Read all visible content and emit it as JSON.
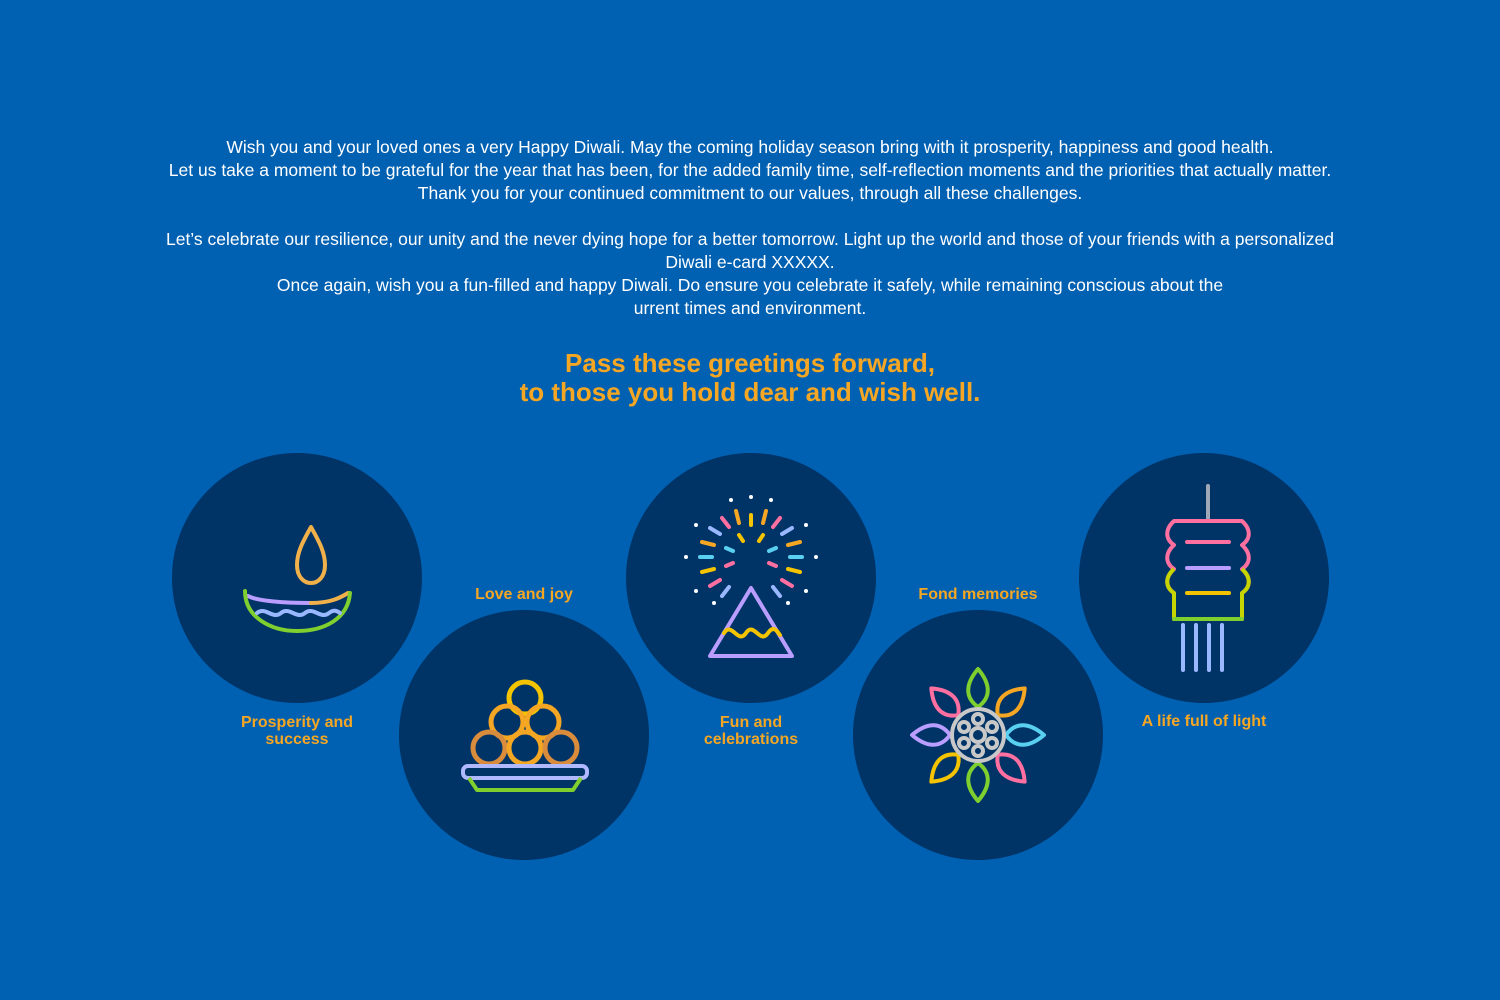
{
  "message": {
    "lines": [
      "Wish you and your loved ones a very Happy Diwali. May the coming holiday season bring with it prosperity, happiness and good health.",
      "Let us take a moment to be grateful for the year that has been, for the added family time, self-reflection moments and the priorities that actually matter.",
      "Thank you for your continued commitment to our values, through all these challenges.",
      "Let’s celebrate our resilience, our unity and the never dying hope for a better tomorrow. Light up the world and those of your friends with a personalized",
      "Diwali e-card XXXXX.",
      "Once again, wish you a fun-filled and happy Diwali. Do ensure you celebrate it safely, while remaining conscious about the",
      "urrent times and environment."
    ]
  },
  "cta": {
    "line1": "Pass these greetings forward,",
    "line2": "to those you hold dear and wish well."
  },
  "cards": [
    {
      "icon": "diya-lamp-icon",
      "label_line1": "Prosperity and",
      "label_line2": "success"
    },
    {
      "icon": "sweets-plate-icon",
      "label_line1": "Love and joy",
      "label_line2": ""
    },
    {
      "icon": "fireworks-icon",
      "label_line1": "Fun and",
      "label_line2": "celebrations"
    },
    {
      "icon": "rangoli-flower-icon",
      "label_line1": "Fond memories",
      "label_line2": ""
    },
    {
      "icon": "hanging-lantern-icon",
      "label_line1": "A life full of light",
      "label_line2": ""
    }
  ],
  "colors": {
    "background": "#0060b1",
    "circle": "#003366",
    "accent": "#f5a623",
    "text": "#ffffff"
  }
}
